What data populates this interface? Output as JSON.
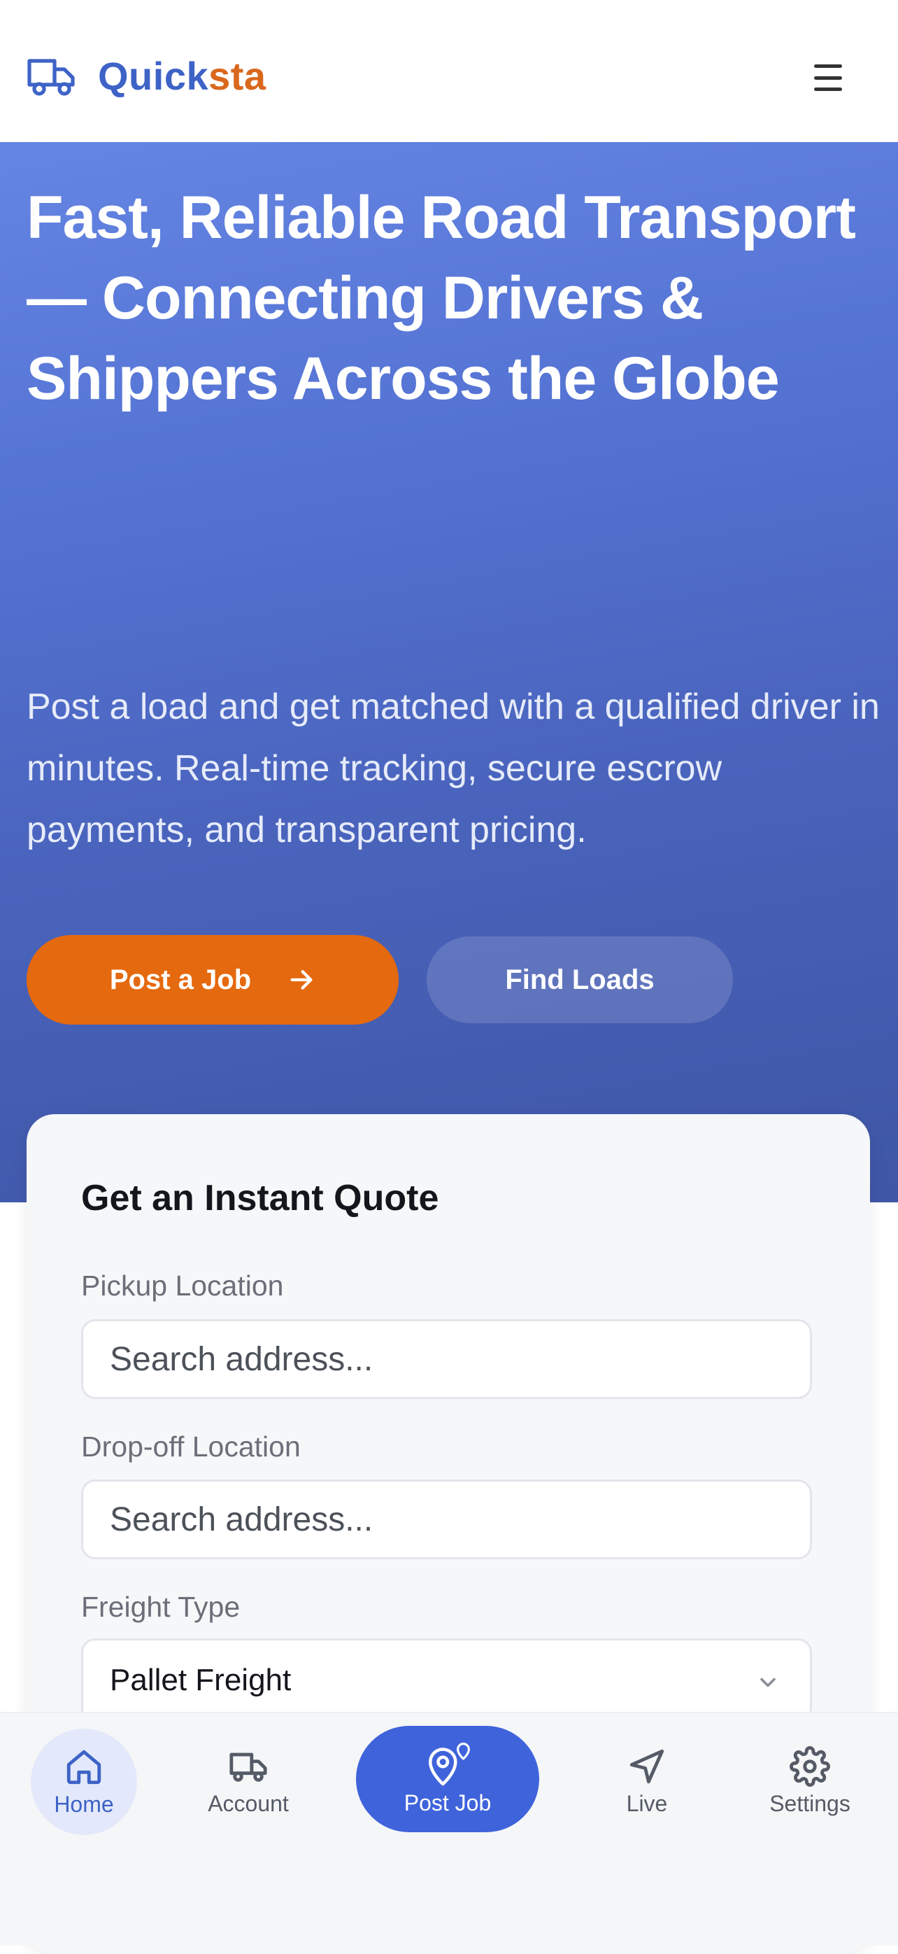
{
  "header": {
    "brand_part1": "Quick",
    "brand_part2": "sta",
    "logo_icon": "truck-icon",
    "menu_icon": "hamburger-menu-icon"
  },
  "hero": {
    "title": "Fast, Reliable Road Transport — Connecting Drivers & Shippers Across the Globe",
    "subtitle": "Post a load and get matched with a qualified driver in minutes. Real-time tracking, secure escrow payments, and transparent pricing.",
    "primary_button": "Post a Job",
    "primary_button_icon": "arrow-right-icon",
    "secondary_button": "Find Loads"
  },
  "quote": {
    "title": "Get an Instant Quote",
    "pickup_label": "Pickup Location",
    "pickup_placeholder": "Search address...",
    "dropoff_label": "Drop-off Location",
    "dropoff_placeholder": "Search address...",
    "freight_label": "Freight Type",
    "freight_value": "Pallet Freight"
  },
  "bottom_nav": {
    "items": [
      {
        "label": "Home",
        "icon": "home-icon",
        "active": true
      },
      {
        "label": "Account",
        "icon": "truck-icon"
      },
      {
        "label": "Post Job",
        "icon": "map-pin-icon"
      },
      {
        "label": "Live",
        "icon": "navigation-arrow-icon"
      },
      {
        "label": "Settings",
        "icon": "gear-icon"
      }
    ]
  },
  "colors": {
    "brand_blue": "#3e63c7",
    "brand_orange": "#d9681e",
    "cta_orange": "#e5690e",
    "nav_active_blue": "#3f63db"
  }
}
